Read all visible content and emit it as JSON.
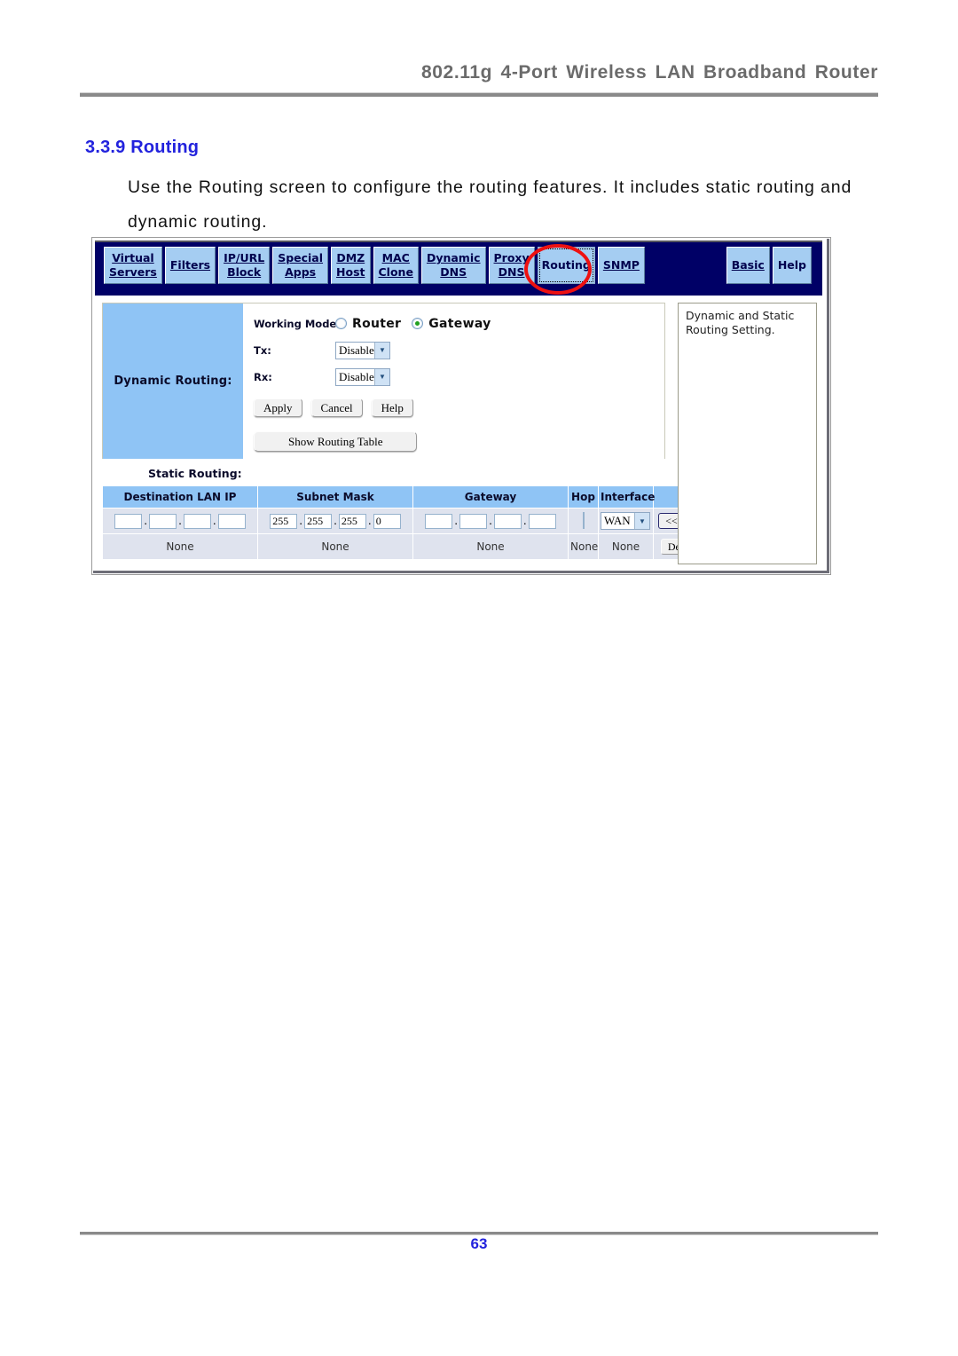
{
  "document": {
    "header_title": "802.11g 4-Port Wireless LAN Broadband Router",
    "section_number_title": "3.3.9 Routing",
    "paragraph": "Use the Routing screen to configure the routing features. It includes static routing and dynamic routing.",
    "page_number": "63"
  },
  "router_ui": {
    "tabs_left": [
      {
        "line1": "Virtual",
        "line2": "Servers"
      },
      {
        "line1": "Filters",
        "line2": ""
      },
      {
        "line1": "IP/URL",
        "line2": "Block"
      },
      {
        "line1": "Special",
        "line2": "Apps"
      },
      {
        "line1": "DMZ",
        "line2": "Host"
      },
      {
        "line1": "MAC",
        "line2": "Clone"
      },
      {
        "line1": "Dynamic",
        "line2": "DNS"
      },
      {
        "line1": "Proxy",
        "line2": "DNS"
      },
      {
        "line1": "Routing",
        "line2": ""
      },
      {
        "line1": "SNMP",
        "line2": ""
      }
    ],
    "tabs_right": [
      {
        "line1": "Basic",
        "line2": ""
      },
      {
        "line1": "Help",
        "line2": ""
      }
    ],
    "active_tab": "Routing",
    "annotation": {
      "shape": "red-ellipse",
      "target": "Routing"
    },
    "dynamic_routing": {
      "label": "Dynamic Routing:",
      "working_mode_label": "Working Mode:",
      "mode_options": [
        {
          "label": "Router",
          "selected": false
        },
        {
          "label": "Gateway",
          "selected": true
        }
      ],
      "tx_label": "Tx:",
      "tx_value": "Disable",
      "rx_label": "Rx:",
      "rx_value": "Disable",
      "buttons": {
        "apply": "Apply",
        "cancel": "Cancel",
        "help": "Help",
        "show_routing_table": "Show Routing Table"
      }
    },
    "static_routing": {
      "title": "Static Routing:",
      "columns": [
        "Destination LAN IP",
        "Subnet Mask",
        "Gateway",
        "Hop",
        "Interface",
        ""
      ],
      "input_row": {
        "destination_lan_ip": [
          "",
          "",
          "",
          ""
        ],
        "subnet_mask": [
          "255",
          "255",
          "255",
          "0"
        ],
        "gateway": [
          "",
          "",
          "",
          ""
        ],
        "hop": "",
        "interface": "WAN",
        "add_button": "<< Add"
      },
      "entry_row": {
        "destination_lan_ip": "None",
        "subnet_mask": "None",
        "gateway": "None",
        "hop": "None",
        "interface": "None",
        "delete_button": "Delete"
      }
    },
    "help_panel": {
      "text": "Dynamic and Static\nRouting Setting."
    }
  },
  "colors": {
    "accent_blue": "#2222dd",
    "navbar_navy": "#000066",
    "tab_blue": "#a5cdf2",
    "panel_blue": "#8fc4f5",
    "annotation_red": "#ee1111"
  }
}
